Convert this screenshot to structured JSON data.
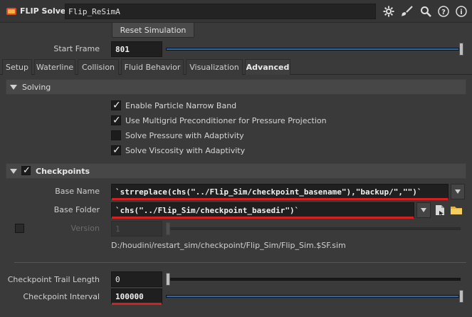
{
  "header": {
    "node_type": "FLIP Solver",
    "node_name": "Flip_ReSimA",
    "icons": [
      "gear-icon",
      "brush-icon",
      "search-icon",
      "help-icon",
      "info-icon"
    ]
  },
  "actions": {
    "reset_label": "Reset Simulation"
  },
  "start_frame": {
    "label": "Start Frame",
    "value": "801"
  },
  "tabs": [
    {
      "label": "Setup"
    },
    {
      "label": "Waterline"
    },
    {
      "label": "Collision"
    },
    {
      "label": "Fluid Behavior"
    },
    {
      "label": "Visualization"
    },
    {
      "label": "Advanced",
      "active": true
    }
  ],
  "solving": {
    "title": "Solving",
    "options": [
      {
        "label": "Enable Particle Narrow Band",
        "checked": true
      },
      {
        "label": "Use Multigrid Preconditioner for Pressure Projection",
        "checked": true
      },
      {
        "label": "Solve Pressure with Adaptivity",
        "checked": false
      },
      {
        "label": "Solve Viscosity with Adaptivity",
        "checked": true
      }
    ]
  },
  "checkpoints": {
    "title": "Checkpoints",
    "enabled": true,
    "base_name": {
      "label": "Base Name",
      "value": "`strreplace(chs(\"../Flip_Sim/checkpoint_basename\"),\"backup/\",\"\")`"
    },
    "base_folder": {
      "label": "Base Folder",
      "value": "`chs(\"../Flip_Sim/checkpoint_basedir\")`"
    },
    "version": {
      "label": "Version",
      "value": "1",
      "enabled": false
    },
    "resolved_path": "D:/houdini/restart_sim/checkpoint/Flip_Sim/Flip_Sim.$SF.sim",
    "trail_length": {
      "label": "Checkpoint Trail Length",
      "value": "0"
    },
    "interval": {
      "label": "Checkpoint Interval",
      "value": "100000"
    }
  },
  "colors": {
    "highlight_red": "#d42020",
    "slider_blue": "#2e64a8"
  }
}
